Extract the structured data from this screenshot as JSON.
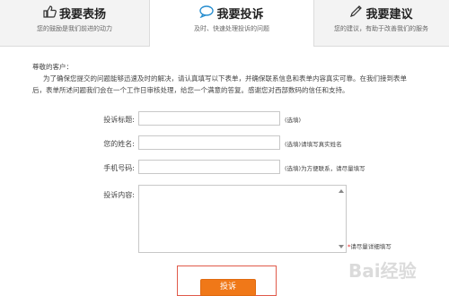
{
  "tabs": [
    {
      "title": "我要表扬",
      "subtitle": "您的鼓励是我们前进的动力",
      "icon": "thumbs-up-icon"
    },
    {
      "title": "我要投诉",
      "subtitle": "及时、快速处理投诉的问题",
      "icon": "speech-bubble-icon"
    },
    {
      "title": "我要建议",
      "subtitle": "您的建议，有助于改善我们的服务",
      "icon": "pencil-icon"
    }
  ],
  "intro": {
    "greeting": "尊敬的客户：",
    "paragraph": "为了确保您提交的问题能够迅速及时的解决，请认真填写以下表单，并确保联系信息和表单内容真实可靠。在我们接到表单后，表单所述问题我们会在一个工作日审核处理，给您一个满意的答复。感谢您对西部数码的信任和支持。"
  },
  "form": {
    "title_label": "投诉标题:",
    "title_value": "",
    "title_hint": "(选填)",
    "name_label": "您的姓名:",
    "name_value": "",
    "name_hint": "(选填)请填写真实姓名",
    "phone_label": "手机号码:",
    "phone_value": "",
    "phone_hint": "(选填)为方便联系，请尽量填写",
    "content_label": "投诉内容:",
    "content_hint_mark": "*",
    "content_hint": "请尽量详细填写",
    "submit_label": "投诉"
  },
  "watermark": {
    "text": "Bai经验"
  },
  "colors": {
    "accent": "#f07818",
    "highlight_box": "#e05a4a",
    "tab_bg": "#f3f3f3",
    "required": "#e02020"
  }
}
